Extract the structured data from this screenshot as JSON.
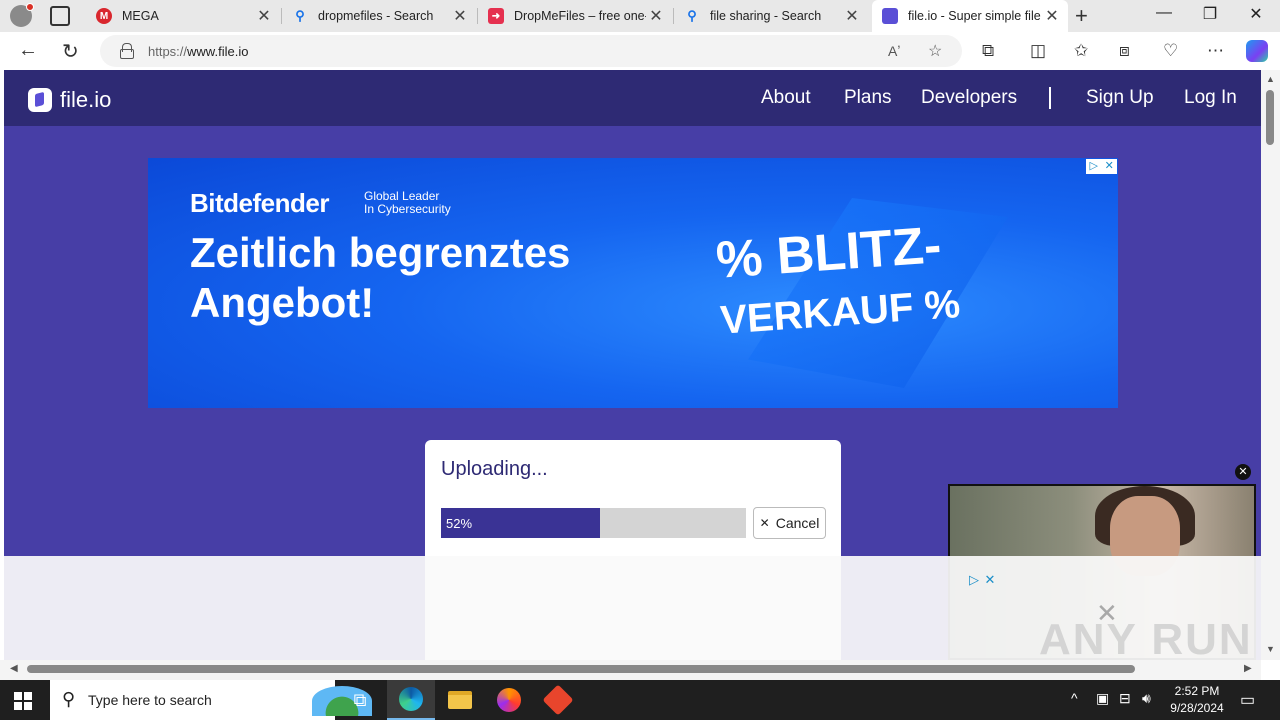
{
  "browser": {
    "tabs": [
      {
        "title": "MEGA",
        "favicon": "mega-icon",
        "color": "#d9272e"
      },
      {
        "title": "dropmefiles - Search",
        "favicon": "search-icon",
        "color": "#1a73e8"
      },
      {
        "title": "DropMeFiles – free one-c",
        "favicon": "dropmefiles-icon",
        "color": "#e5304f"
      },
      {
        "title": "file sharing - Search",
        "favicon": "search-icon",
        "color": "#1a73e8"
      },
      {
        "title": "file.io - Super simple file",
        "favicon": "fileio-icon",
        "color": "#5a4fd6"
      }
    ],
    "url_scheme": "https://",
    "url_host": "www.file.io"
  },
  "site": {
    "logo_text": "file.io",
    "nav": {
      "about": "About",
      "plans": "Plans",
      "developers": "Developers",
      "sign_up": "Sign Up",
      "log_in": "Log In"
    },
    "colors": {
      "header": "#2e2a74",
      "background": "#473ea6",
      "accent": "#3a3395"
    }
  },
  "ad": {
    "brand": "Bitdefender",
    "tagline_1": "Global Leader",
    "tagline_2": "In Cybersecurity",
    "headline": "Zeitlich begrenztes Angebot!",
    "promo_1": "% BLITZ-",
    "promo_2": "VERKAUF %"
  },
  "upload": {
    "title": "Uploading...",
    "progress": 0.52,
    "progress_label": "52%",
    "cancel_label": "Cancel"
  },
  "watermark": "ANY RUN",
  "taskbar": {
    "search_placeholder": "Type here to search",
    "time": "2:52 PM",
    "date": "9/28/2024"
  }
}
